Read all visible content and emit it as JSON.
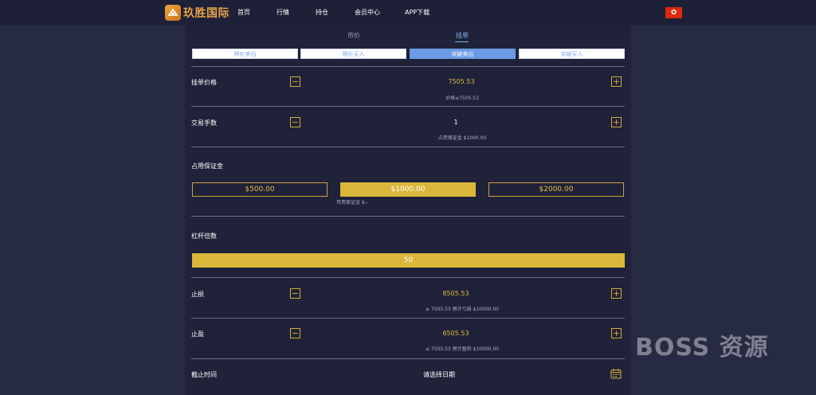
{
  "nav": {
    "logo_text": "玖胜国际",
    "items": [
      {
        "label": "首页"
      },
      {
        "label": "行情"
      },
      {
        "label": "持仓"
      },
      {
        "label": "会员中心"
      },
      {
        "label": "APP下载"
      }
    ],
    "flag_symbol": "✿"
  },
  "tabs": [
    {
      "label": "市价",
      "active": false
    },
    {
      "label": "挂单",
      "active": true
    }
  ],
  "order_types": [
    {
      "label": "限价卖出",
      "active": false
    },
    {
      "label": "限价买入",
      "active": false
    },
    {
      "label": "突破卖出",
      "active": true
    },
    {
      "label": "突破买入",
      "active": false
    }
  ],
  "order_price": {
    "label": "挂单价格",
    "value": "7505.53",
    "hint": "价格≤7505.53"
  },
  "trade_lots": {
    "label": "交易手数",
    "value": "1",
    "hint": "占用保证金 $1000.00"
  },
  "margin": {
    "label": "占用保证金",
    "options": [
      {
        "label": "$500.00",
        "active": false
      },
      {
        "label": "$1000.00",
        "active": true
      },
      {
        "label": "$2000.00",
        "active": false
      }
    ],
    "available_hint": "可用保证金 $--"
  },
  "leverage": {
    "label": "杠杆倍数",
    "value": "50"
  },
  "stop_loss": {
    "label": "止损",
    "value": "8505.53",
    "hint": "≥ 7505.53 预计亏损 $10000.00"
  },
  "take_profit": {
    "label": "止盈",
    "value": "6505.53",
    "hint": "≤ 7505.53 预计盈利 $10000.00"
  },
  "expiry": {
    "label": "截止时间",
    "placeholder": "请选择日期"
  },
  "stepper": {
    "minus": "−",
    "plus": "+"
  },
  "watermark": "BOSS 资源",
  "colors": {
    "accent_gold": "#d9b73a",
    "accent_blue": "#6b9be4",
    "background": "#262a42",
    "panel": "#1f2238"
  }
}
